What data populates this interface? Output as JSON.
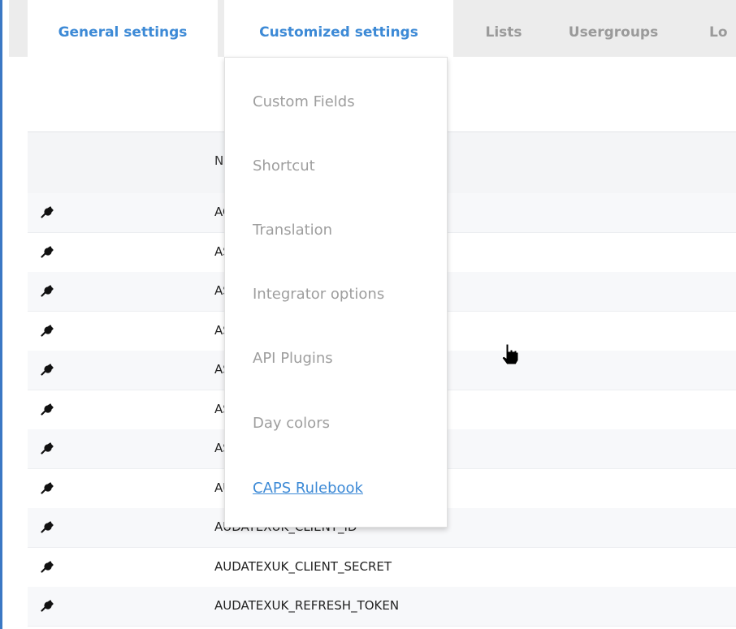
{
  "tabs": [
    {
      "label": "General settings",
      "active": true
    },
    {
      "label": "Customized settings",
      "active": true
    },
    {
      "label": "Lists",
      "active": false
    },
    {
      "label": "Usergroups",
      "active": false
    },
    {
      "label": "Lo",
      "active": false
    }
  ],
  "table": {
    "header": {
      "name": "Na"
    },
    "rows": [
      {
        "name": "AC",
        "icon": "wrench-icon"
      },
      {
        "name": "AS",
        "icon": "wrench-icon"
      },
      {
        "name": "AS",
        "icon": "wrench-icon"
      },
      {
        "name": "AS",
        "icon": "wrench-icon"
      },
      {
        "name": "AS",
        "icon": "wrench-icon"
      },
      {
        "name": "AS",
        "icon": "wrench-icon"
      },
      {
        "name": "AS",
        "icon": "wrench-icon"
      },
      {
        "name": "AU",
        "icon": "wrench-icon"
      },
      {
        "name": "AUDATEXUK_CLIENT_ID",
        "icon": "wrench-icon"
      },
      {
        "name": "AUDATEXUK_CLIENT_SECRET",
        "icon": "wrench-icon"
      },
      {
        "name": "AUDATEXUK_REFRESH_TOKEN",
        "icon": "wrench-icon"
      }
    ]
  },
  "dropdown": {
    "items": [
      {
        "label": "Custom Fields"
      },
      {
        "label": "Shortcut"
      },
      {
        "label": "Translation"
      },
      {
        "label": "Integrator options"
      },
      {
        "label": "API Plugins"
      },
      {
        "label": "Day colors"
      },
      {
        "label": "CAPS Rulebook"
      }
    ]
  },
  "colors": {
    "accent": "#3d8ad6",
    "tabbar_bg": "#ececec",
    "muted_text": "#9e9e9e"
  }
}
